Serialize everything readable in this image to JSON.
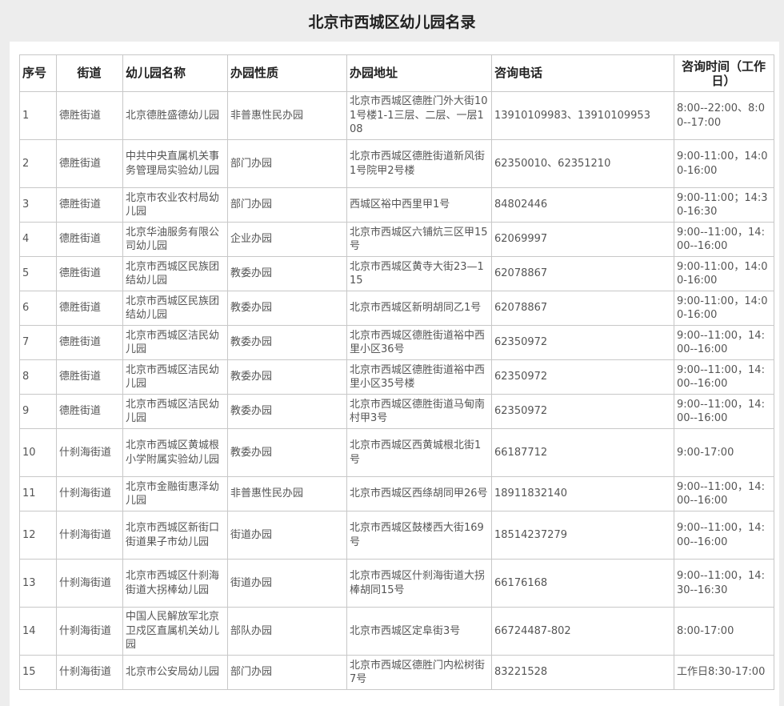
{
  "page_title": "北京市西城区幼儿园名录",
  "table": {
    "headers": [
      "序号",
      "街道",
      "幼儿园名称",
      "办园性质",
      "办园地址",
      "咨询电话",
      "咨询时间（工作日）"
    ],
    "rows": [
      {
        "no": "1",
        "street": "德胜街道",
        "name": "北京德胜盛德幼儿园",
        "type": "非普惠性民办园",
        "address": "北京市西城区德胜门外大街101号楼1-1三层、二层、一层108",
        "phone": "13910109983、13910109953",
        "time": "8:00--22:00、8:00--17:00"
      },
      {
        "no": "2",
        "street": "德胜街道",
        "name": "中共中央直属机关事务管理局实验幼儿园",
        "type": "部门办园",
        "address": "北京市西城区德胜街道新风街1号院甲2号楼",
        "phone": "62350010、62351210",
        "time": "9:00-11:00，14:00-16:00"
      },
      {
        "no": "3",
        "street": "德胜街道",
        "name": "北京市农业农村局幼儿园",
        "type": "部门办园",
        "address": "西城区裕中西里甲1号",
        "phone": "84802446",
        "time": "9:00-11:00；14:30-16:30"
      },
      {
        "no": "4",
        "street": "德胜街道",
        "name": "北京华油服务有限公司幼儿园",
        "type": "企业办园",
        "address": "北京市西城区六铺炕三区甲15号",
        "phone": "62069997",
        "time": "9:00--11:00，14:00--16:00"
      },
      {
        "no": "5",
        "street": "德胜街道",
        "name": "北京市西城区民族团结幼儿园",
        "type": "教委办园",
        "address": "北京市西城区黄寺大街23—115",
        "phone": "62078867",
        "time": "9:00-11:00，14:00-16:00"
      },
      {
        "no": "6",
        "street": "德胜街道",
        "name": "北京市西城区民族团结幼儿园",
        "type": "教委办园",
        "address": "北京市西城区新明胡同乙1号",
        "phone": "62078867",
        "time": "9:00-11:00，14:00-16:00"
      },
      {
        "no": "7",
        "street": "德胜街道",
        "name": "北京市西城区洁民幼儿园",
        "type": "教委办园",
        "address": "北京市西城区德胜街道裕中西里小区36号",
        "phone": "62350972",
        "time": "9:00--11:00，14:00--16:00"
      },
      {
        "no": "8",
        "street": "德胜街道",
        "name": "北京市西城区洁民幼儿园",
        "type": "教委办园",
        "address": "北京市西城区德胜街道裕中西里小区35号楼",
        "phone": "62350972",
        "time": "9:00--11:00，14:00--16:00"
      },
      {
        "no": "9",
        "street": "德胜街道",
        "name": "北京市西城区洁民幼儿园",
        "type": "教委办园",
        "address": "北京市西城区德胜街道马甸南村甲3号",
        "phone": "62350972",
        "time": "9:00--11:00，14:00--16:00"
      },
      {
        "no": "10",
        "street": "什刹海街道",
        "name": "北京市西城区黄城根小学附属实验幼儿园",
        "type": "教委办园",
        "address": "北京市西城区西黄城根北街1号",
        "phone": "66187712",
        "time": "9:00-17:00"
      },
      {
        "no": "11",
        "street": "什刹海街道",
        "name": "北京市金融街惠泽幼儿园",
        "type": "非普惠性民办园",
        "address": "北京市西城区西绦胡同甲26号",
        "phone": "18911832140",
        "time": "9:00--11:00，14:00--16:00"
      },
      {
        "no": "12",
        "street": "什刹海街道",
        "name": "北京市西城区新街口街道果子市幼儿园",
        "type": "街道办园",
        "address": "北京市西城区鼓楼西大街169号",
        "phone": "18514237279",
        "time": "9:00--11:00，14:00--16:00"
      },
      {
        "no": "13",
        "street": "什刹海街道",
        "name": "北京市西城区什刹海街道大拐棒幼儿园",
        "type": "街道办园",
        "address": "北京市西城区什刹海街道大拐棒胡同15号",
        "phone": "66176168",
        "time": "9:00--11:00，14:30--16:30"
      },
      {
        "no": "14",
        "street": "什刹海街道",
        "name": "中国人民解放军北京卫戍区直属机关幼儿园",
        "type": "部队办园",
        "address": "北京市西城区定阜街3号",
        "phone": "66724487-802",
        "time": "8:00-17:00"
      },
      {
        "no": "15",
        "street": "什刹海街道",
        "name": "北京市公安局幼儿园",
        "type": "部门办园",
        "address": "北京市西城区德胜门内松树街7号",
        "phone": "83221528",
        "time": "工作日8:30-17:00"
      }
    ]
  }
}
